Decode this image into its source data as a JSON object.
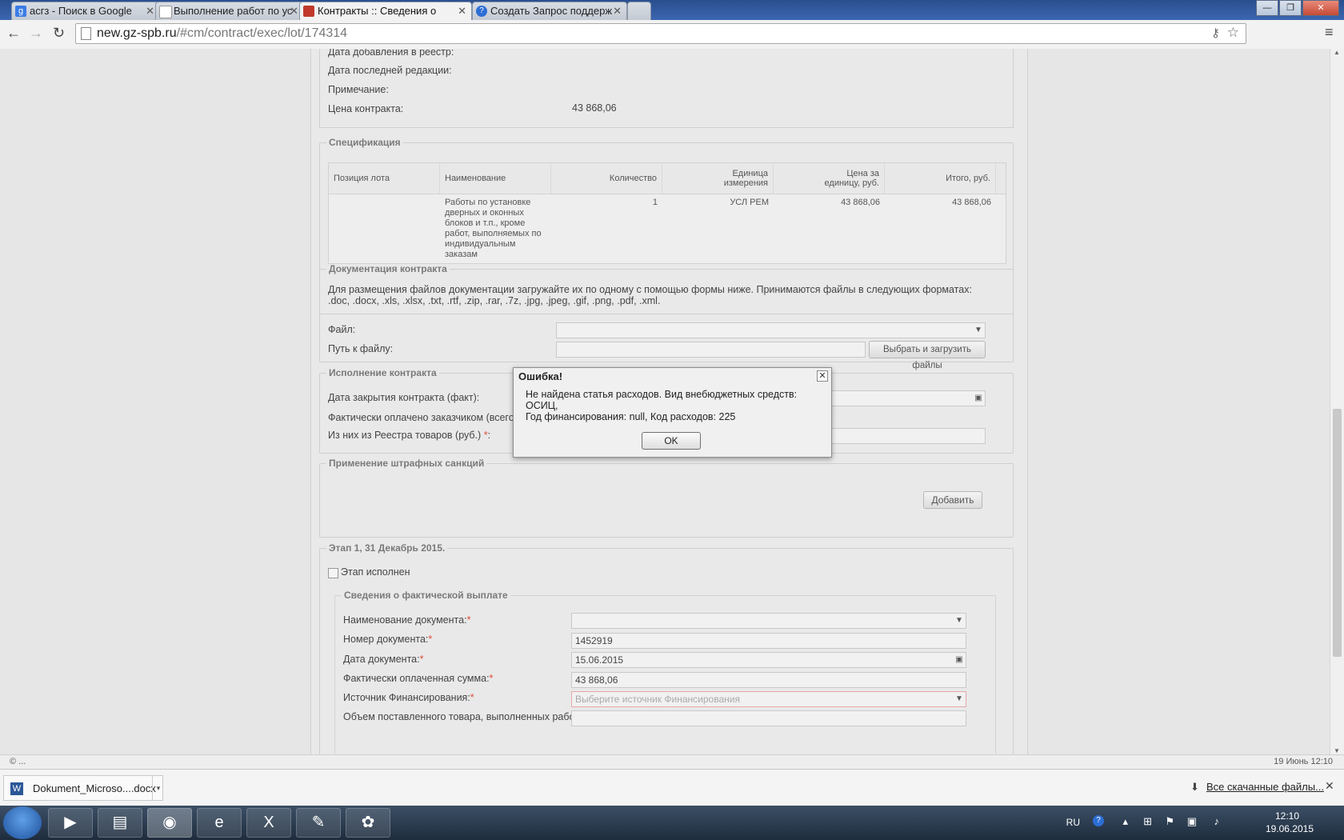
{
  "tabs": [
    {
      "label": "асгз - Поиск в Google",
      "fav_color": "#3b7be6"
    },
    {
      "label": "Выполнение работ по ус",
      "fav_color": "#dddddd"
    },
    {
      "label": "Контракты :: Сведения о",
      "fav_color": "#c0392b"
    },
    {
      "label": "Создать Запрос поддерж",
      "fav_color": "#2c6ed5"
    }
  ],
  "address": {
    "host": "new.gz-spb.ru",
    "path": "/#cm/contract/exec/lot/174314"
  },
  "info": {
    "date_added_label": "Дата добавления в реестр:",
    "date_edit_label": "Дата последней редакции:",
    "note_label": "Примечание:",
    "price_label": "Цена контракта:",
    "price_value": "43 868,06"
  },
  "spec": {
    "legend": "Спецификация",
    "headers": [
      "Позиция лота",
      "Наименование",
      "Количество",
      "Единица измерения",
      "Цена за единицу, руб.",
      "Итого, руб."
    ],
    "row": {
      "name_lines": [
        "Работы по установке",
        "дверных и оконных",
        "блоков и т.п., кроме",
        "работ, выполняемых по",
        "индивидуальным",
        "заказам"
      ],
      "qty": "1",
      "unit": "УСЛ РЕМ",
      "price": "43 868,06",
      "total": "43 868,06"
    }
  },
  "docs": {
    "legend": "Документация контракта",
    "text": "Для размещения файлов документации загружайте их по одному с помощью формы ниже. Принимаются файлы в следующих форматах: .doc, .docx, .xls, .xlsx, .txt, .rtf, .zip, .rar, .7z, .jpg, .jpeg, .gif, .png, .pdf, .xml.",
    "file_label": "Файл:",
    "path_label": "Путь к файлу:",
    "upload_button": "Выбрать и загрузить файлы"
  },
  "exec": {
    "legend": "Исполнение контракта",
    "close_date_label": "Дата закрытия контракта (факт):",
    "paid_label": "Фактически оплачено заказчиком (всего",
    "registry_label": "Из них из Реестра товаров (руб.)"
  },
  "penalties": {
    "legend": "Применение штрафных санкций",
    "add_button": "Добавить"
  },
  "stage": {
    "legend": "Этап 1, 31 Декабрь 2015.",
    "done_label": "Этап исполнен",
    "payment_legend": "Сведения о фактической выплате",
    "doc_name_label": "Наименование документа:",
    "doc_number_label": "Номер документа:",
    "doc_number_value": "1452919",
    "doc_date_label": "Дата документа:",
    "doc_date_value": "15.06.2015",
    "paid_sum_label": "Фактически оплаченная сумма:",
    "paid_sum_value": "43 868,06",
    "source_label": "Источник Финансирования:",
    "source_placeholder": "Выберите источник Финансирования",
    "volume_label": "Объем поставленного товара, выполненных работ,"
  },
  "dialog": {
    "title": "Ошибка!",
    "message_line1": "Не найдена статья расходов. Вид внебюджетных средств: ОСИЦ,",
    "message_line2": "Год финансирования: null, Код расходов: 225",
    "ok": "OK"
  },
  "status": {
    "left": "© ...",
    "right": "19 Июнь 12:10"
  },
  "download": {
    "file": "Dokument_Microso....docx",
    "all_link": "Все скачанные файлы..."
  },
  "tray": {
    "lang": "RU",
    "time": "12:10",
    "date": "19.06.2015"
  }
}
